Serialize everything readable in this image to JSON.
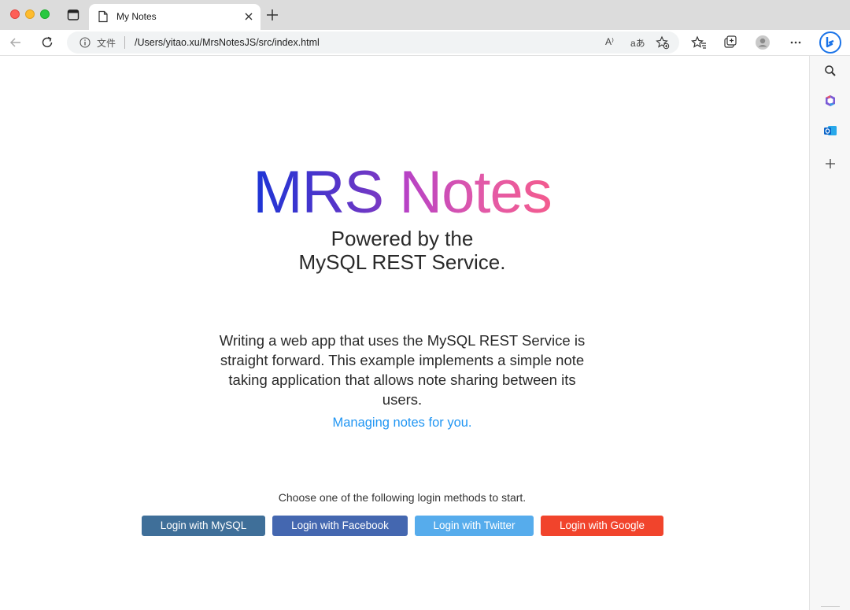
{
  "browser": {
    "tab": {
      "title": "My Notes"
    },
    "address": {
      "scheme_label": "文件",
      "url": "/Users/yitao.xu/MrsNotesJS/src/index.html"
    },
    "omnibox_icons": {
      "read_aloud": "A⁾",
      "translate": "aあ"
    }
  },
  "page": {
    "brand": {
      "part1": "MRS",
      "part2": "Notes"
    },
    "tagline_line1": "Powered by the",
    "tagline_line2": "MySQL REST Service.",
    "description": "Writing a web app that uses the MySQL REST Service is straight forward. This example implements a simple note taking application that allows note sharing between its users.",
    "motto": "Managing notes for you.",
    "login_prompt": "Choose one of the following login methods to start.",
    "login_buttons": [
      {
        "label": "Login with MySQL",
        "color": "#3f6f99"
      },
      {
        "label": "Login with Facebook",
        "color": "#4467b0"
      },
      {
        "label": "Login with Twitter",
        "color": "#56acec"
      },
      {
        "label": "Login with Google",
        "color": "#f1442c"
      }
    ]
  },
  "colors": {
    "brand_blue": "#1c35d6",
    "brand_pink": "#f35b8e",
    "link_blue": "#2196f3"
  }
}
